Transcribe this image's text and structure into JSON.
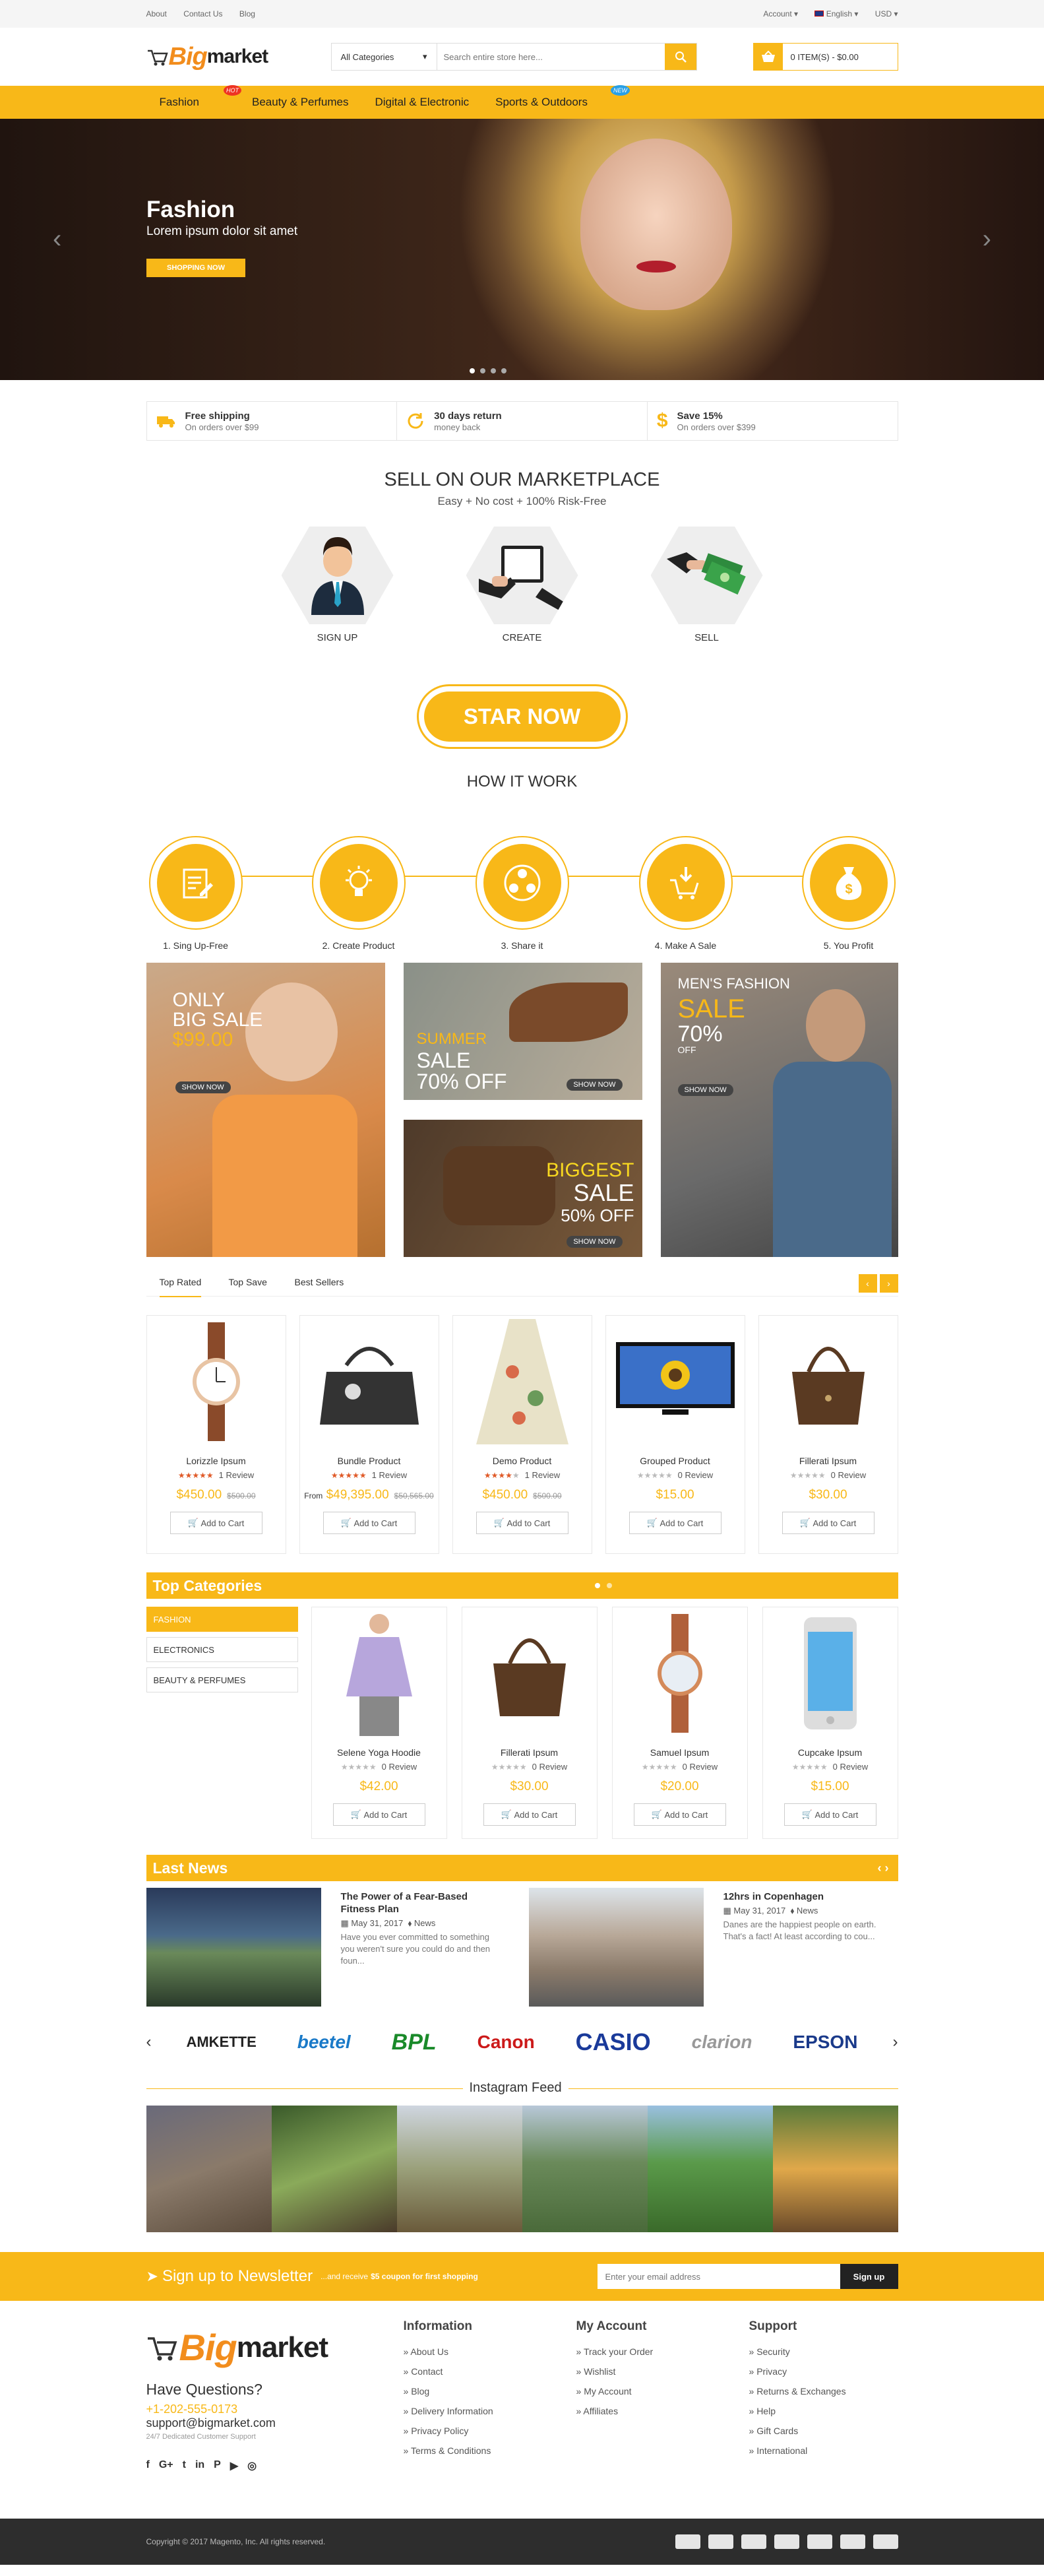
{
  "topbar": {
    "links": [
      "About",
      "Contact Us",
      "Blog"
    ],
    "account": "Account",
    "language": "English",
    "currency": "USD"
  },
  "header": {
    "logo_big": "Big",
    "logo_market": "market",
    "category": "All Categories",
    "search_placeholder": "Search entire store here...",
    "cart": "0 ITEM(S) - $0.00"
  },
  "nav": {
    "items": [
      "Fashion",
      "Beauty & Perfumes",
      "Digital & Electronic",
      "Sports & Outdoors"
    ],
    "hot": "HOT",
    "new": "NEW"
  },
  "hero": {
    "title": "Fashion",
    "subtitle": "Lorem ipsum dolor sit amet",
    "button": "SHOPPING NOW"
  },
  "features": [
    {
      "title": "Free shipping",
      "sub": "On orders over $99"
    },
    {
      "title": "30 days return",
      "sub": "money back"
    },
    {
      "title": "Save 15%",
      "sub": "On orders over $399"
    }
  ],
  "marketplace": {
    "title": "SELL ON OUR MARKETPLACE",
    "subtitle": "Easy + No cost + 100% Risk-Free",
    "items": [
      "SIGN UP",
      "CREATE",
      "SELL"
    ],
    "button": "STAR NOW"
  },
  "howitwork": {
    "title": "HOW IT WORK",
    "steps": [
      "1. Sing Up-Free",
      "2. Create Product",
      "3. Share it",
      "4. Make A Sale",
      "5. You Profit"
    ]
  },
  "banners": {
    "b1": {
      "l1": "ONLY",
      "l2": "BIG SALE",
      "l3": "$99.00",
      "btn": "SHOW NOW"
    },
    "b2": {
      "l1": "SUMMER",
      "l2": "SALE",
      "l3": "70% OFF",
      "btn": "SHOW NOW"
    },
    "b3": {
      "l1": "BIGGEST",
      "l2": "SALE",
      "l3": "50% OFF",
      "btn": "SHOW NOW"
    },
    "b4": {
      "l1": "MEN'S FASHION",
      "l2": "SALE",
      "l3": "70%",
      "l4": "OFF",
      "btn": "SHOW NOW"
    }
  },
  "tabs": [
    "Top Rated",
    "Top Save",
    "Best Sellers"
  ],
  "products": [
    {
      "name": "Lorizzle Ipsum",
      "review": "1 Review",
      "price": "$450.00",
      "old": "$500.00",
      "prefix": ""
    },
    {
      "name": "Bundle Product",
      "review": "1 Review",
      "price": "$49,395.00",
      "old": "$50,565.00",
      "prefix": "From"
    },
    {
      "name": "Demo Product",
      "review": "1 Review",
      "price": "$450.00",
      "old": "$500.00",
      "prefix": ""
    },
    {
      "name": "Grouped Product",
      "review": "0 Review",
      "price": "$15.00",
      "old": "",
      "prefix": ""
    },
    {
      "name": "Fillerati Ipsum",
      "review": "0 Review",
      "price": "$30.00",
      "old": "",
      "prefix": ""
    }
  ],
  "add_to_cart": "Add to Cart",
  "topcat": {
    "title": "Top Categories",
    "cats": [
      "FASHION",
      "ELECTRONICS",
      "BEAUTY & PERFUMES"
    ],
    "products": [
      {
        "name": "Selene Yoga Hoodie",
        "review": "0 Review",
        "price": "$42.00"
      },
      {
        "name": "Fillerati Ipsum",
        "review": "0 Review",
        "price": "$30.00"
      },
      {
        "name": "Samuel Ipsum",
        "review": "0 Review",
        "price": "$20.00"
      },
      {
        "name": "Cupcake Ipsum",
        "review": "0 Review",
        "price": "$15.00"
      }
    ]
  },
  "news": {
    "title": "Last News",
    "items": [
      {
        "title": "The Power of a Fear-Based Fitness Plan",
        "date": "May 31, 2017",
        "cat": "News",
        "text": "Have you ever committed to something you weren't sure you could do and then foun..."
      },
      {
        "title": "12hrs in Copenhagen",
        "date": "May 31, 2017",
        "cat": "News",
        "text": "Danes are the happiest people on earth. That's a fact! At least according to cou..."
      }
    ]
  },
  "brands": [
    "AMKETTE",
    "beetel",
    "BPL",
    "Canon",
    "CASIO",
    "clarion",
    "EPSON"
  ],
  "instagram": {
    "title": "Instagram Feed"
  },
  "newsletter": {
    "title": "Sign up to Newsletter",
    "text": "...and receive",
    "bold": "$5 coupon for first shopping",
    "placeholder": "Enter your email address",
    "button": "Sign up"
  },
  "footer": {
    "questions": "Have Questions?",
    "phone": "+1-202-555-0173",
    "email": "support@bigmarket.com",
    "support": "24/7 Dedicated Customer Support",
    "cols": [
      {
        "title": "Information",
        "links": [
          "About Us",
          "Contact",
          "Blog",
          "Delivery Information",
          "Privacy Policy",
          "Terms & Conditions"
        ]
      },
      {
        "title": "My Account",
        "links": [
          "Track your Order",
          "Wishlist",
          "My Account",
          "Affiliates"
        ]
      },
      {
        "title": "Support",
        "links": [
          "Security",
          "Privacy",
          "Returns & Exchanges",
          "Help",
          "Gift Cards",
          "International"
        ]
      }
    ],
    "copyright": "Copyright © 2017 Magento, Inc. All rights reserved."
  },
  "colors": {
    "accent": "#f8b818",
    "dark": "#2d2d2d"
  }
}
